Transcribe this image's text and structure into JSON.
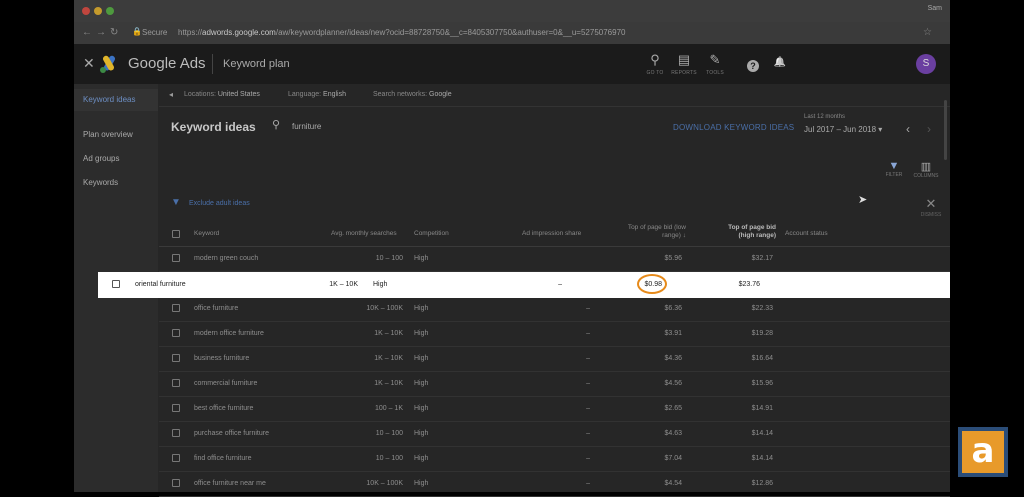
{
  "browser": {
    "user": "Sam",
    "secure_label": "Secure",
    "url_scheme": "https://",
    "url_host": "adwords.google.com",
    "url_path": "/aw/keywordplanner/ideas/new?ocid=88728750&__c=8405307750&authuser=0&__u=5275076970"
  },
  "header": {
    "brand": "Google Ads",
    "section": "Keyword plan",
    "icons": [
      {
        "name": "search-icon",
        "glyph": "⚲",
        "label": "GO TO"
      },
      {
        "name": "reports-icon",
        "glyph": "▤",
        "label": "REPORTS"
      },
      {
        "name": "tools-icon",
        "glyph": "✎",
        "label": "TOOLS"
      },
      {
        "name": "help-icon",
        "glyph": "?",
        "label": ""
      },
      {
        "name": "bell-icon",
        "glyph": "🔔",
        "label": ""
      }
    ],
    "avatar_letter": "S"
  },
  "sidenav": {
    "items": [
      {
        "label": "Keyword ideas",
        "active": true
      },
      {
        "label": "Plan overview",
        "active": false
      },
      {
        "label": "Ad groups",
        "active": false
      },
      {
        "label": "Keywords",
        "active": false
      }
    ]
  },
  "filters": {
    "locations_label": "Locations:",
    "locations_value": "United States",
    "language_label": "Language:",
    "language_value": "English",
    "network_label": "Search networks:",
    "network_value": "Google"
  },
  "toolbar": {
    "title": "Keyword ideas",
    "search_value": "furniture",
    "download_label": "DOWNLOAD KEYWORD IDEAS",
    "period_label": "Last 12 months",
    "date_range": "Jul 2017 – Jun 2018",
    "filter_label": "FILTER",
    "columns_label": "COLUMNS",
    "adult_ideas": "Exclude adult ideas",
    "dismiss_label": "DISMISS"
  },
  "table": {
    "headers": {
      "keyword": "Keyword",
      "searches": "Avg. monthly searches",
      "competition": "Competition",
      "impression_share": "Ad impression share",
      "bid_low": "Top of page bid (low range)",
      "bid_high": "Top of page bid (high range)",
      "status": "Account status"
    },
    "rows": [
      {
        "keyword": "modern green couch",
        "searches": "10 – 100",
        "competition": "High",
        "share": "",
        "low": "$5.96",
        "high": "$32.17"
      },
      {
        "keyword": "oriental furniture",
        "searches": "1K – 10K",
        "competition": "High",
        "share": "–",
        "low": "$0.98",
        "high": "$23.76"
      },
      {
        "keyword": "office furniture",
        "searches": "10K – 100K",
        "competition": "High",
        "share": "–",
        "low": "$6.36",
        "high": "$22.33"
      },
      {
        "keyword": "modern office furniture",
        "searches": "1K – 10K",
        "competition": "High",
        "share": "–",
        "low": "$3.91",
        "high": "$19.28"
      },
      {
        "keyword": "business furniture",
        "searches": "1K – 10K",
        "competition": "High",
        "share": "–",
        "low": "$4.36",
        "high": "$16.64"
      },
      {
        "keyword": "commercial furniture",
        "searches": "1K – 10K",
        "competition": "High",
        "share": "–",
        "low": "$4.56",
        "high": "$15.96"
      },
      {
        "keyword": "best office furniture",
        "searches": "100 – 1K",
        "competition": "High",
        "share": "–",
        "low": "$2.65",
        "high": "$14.91"
      },
      {
        "keyword": "purchase office furniture",
        "searches": "10 – 100",
        "competition": "High",
        "share": "–",
        "low": "$4.63",
        "high": "$14.14"
      },
      {
        "keyword": "find office furniture",
        "searches": "10 – 100",
        "competition": "High",
        "share": "–",
        "low": "$7.04",
        "high": "$14.14"
      },
      {
        "keyword": "office furniture near me",
        "searches": "10K – 100K",
        "competition": "High",
        "share": "–",
        "low": "$4.54",
        "high": "$12.86"
      }
    ]
  },
  "watermark": {
    "letter": "a"
  }
}
